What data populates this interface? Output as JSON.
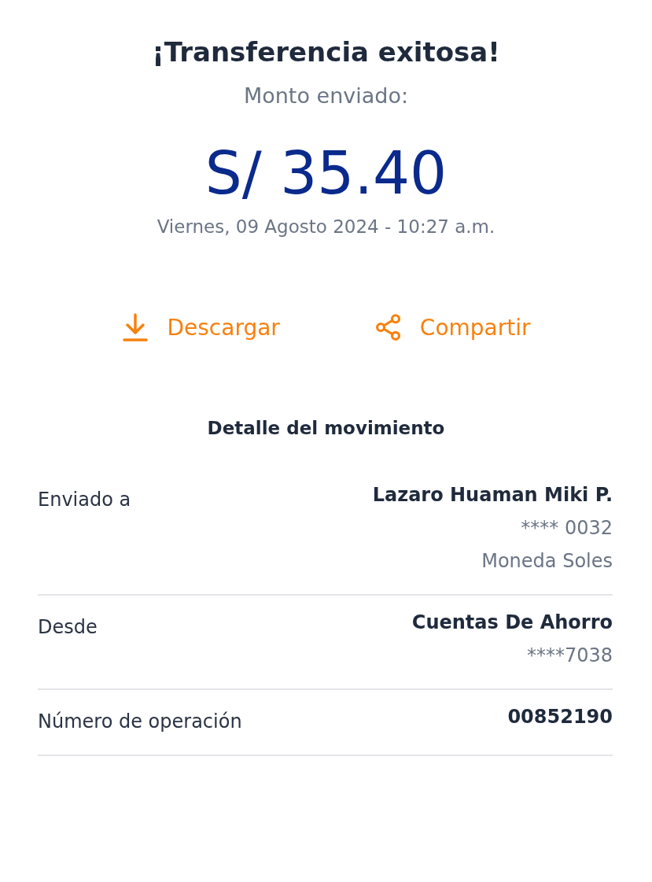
{
  "header": {
    "title": "¡Transferencia exitosa!",
    "subtitle": "Monto enviado:",
    "amount": "S/ 35.40",
    "datetime": "Viernes, 09 Agosto 2024 - 10:27 a.m."
  },
  "actions": [
    {
      "kind": "download",
      "label": "Descargar"
    },
    {
      "kind": "share",
      "label": "Compartir"
    }
  ],
  "details": {
    "title": "Detalle del movimiento",
    "rows": [
      {
        "label": "Enviado a",
        "value": "Lazaro Huaman Miki P.",
        "extra": [
          "**** 0032",
          "Moneda Soles"
        ]
      },
      {
        "label": "Desde",
        "value": "Cuentas De Ahorro",
        "extra": [
          "****7038"
        ]
      },
      {
        "label": "Número de operación",
        "value": "00852190"
      }
    ]
  }
}
